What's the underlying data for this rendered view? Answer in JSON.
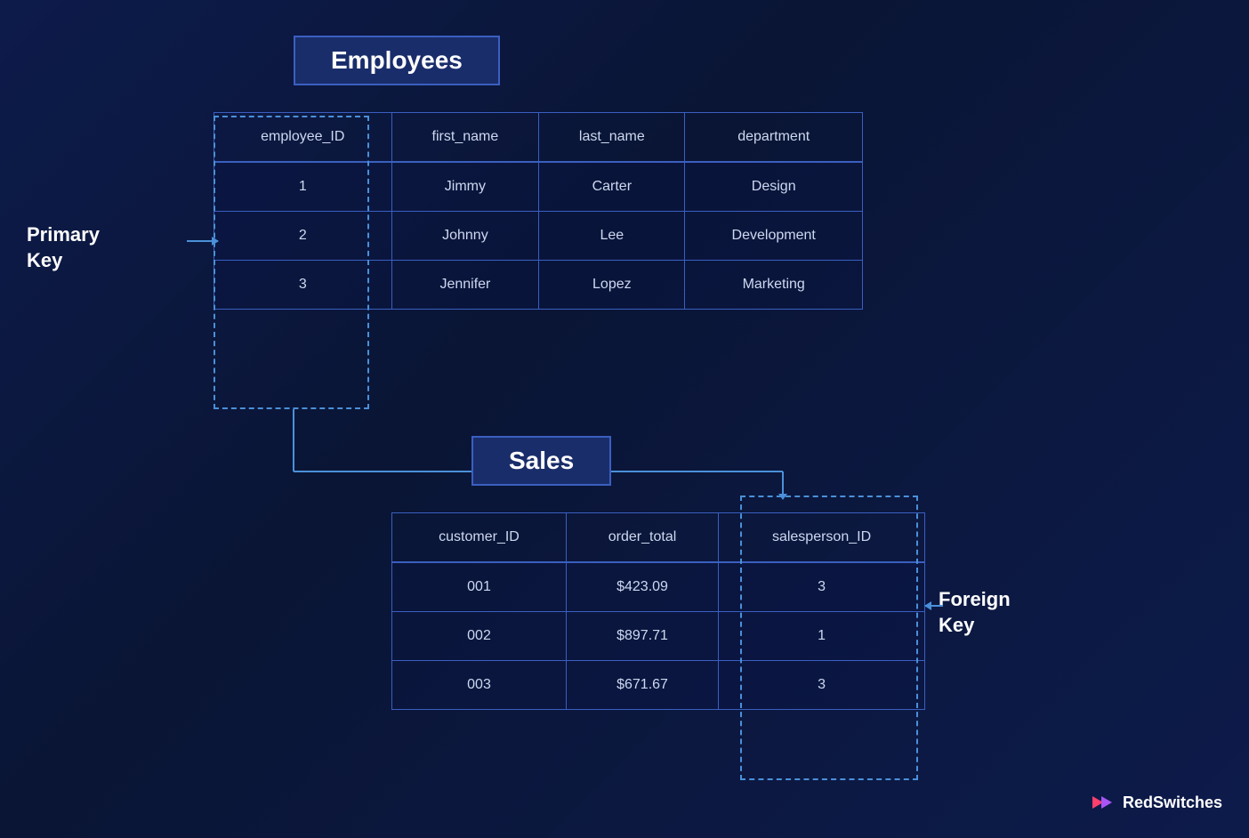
{
  "employees": {
    "title": "Employees",
    "columns": [
      "employee_ID",
      "first_name",
      "last_name",
      "department"
    ],
    "rows": [
      [
        "1",
        "Jimmy",
        "Carter",
        "Design"
      ],
      [
        "2",
        "Johnny",
        "Lee",
        "Development"
      ],
      [
        "3",
        "Jennifer",
        "Lopez",
        "Marketing"
      ]
    ]
  },
  "sales": {
    "title": "Sales",
    "columns": [
      "customer_ID",
      "order_total",
      "salesperson_ID"
    ],
    "rows": [
      [
        "001",
        "$423.09",
        "3"
      ],
      [
        "002",
        "$897.71",
        "1"
      ],
      [
        "003",
        "$671.67",
        "3"
      ]
    ]
  },
  "labels": {
    "primary_key": "Primary\nKey",
    "foreign_key": "Foreign\nKey"
  },
  "brand": {
    "name": "RedSwitches"
  }
}
